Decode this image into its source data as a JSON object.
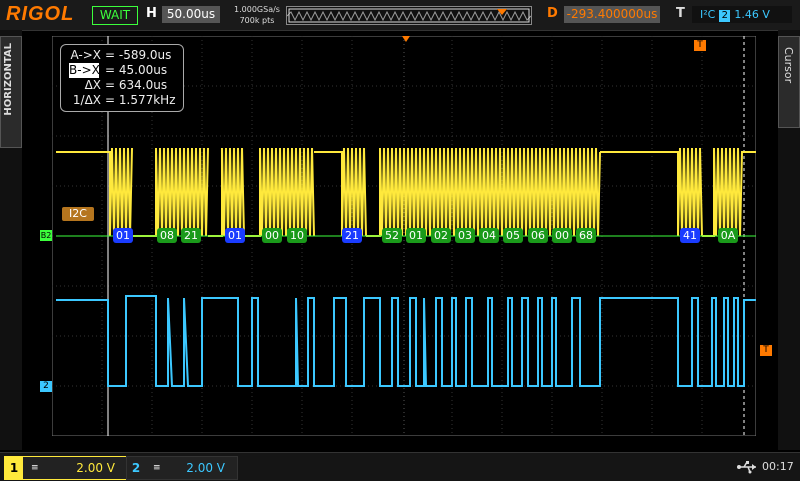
{
  "header": {
    "brand": "RIGOL",
    "status": "WAIT",
    "h_label": "H",
    "timebase": "50.00us",
    "sample_rate": "1.000GSa/s",
    "memory_depth": "700k pts",
    "d_label": "D",
    "delay": "-293.400000us",
    "t_label": "T",
    "trigger_protocol": "I²C",
    "trigger_source": "2",
    "trigger_level": "1.46 V"
  },
  "side_tabs": {
    "left": "HORIZONTAL",
    "right": "Cursor"
  },
  "cursor_readout": {
    "a_key": "A->X",
    "a_value": "= -589.0us",
    "b_key": "B->X",
    "b_value": "= 45.00us",
    "delta_key": "ΔX",
    "delta_value": "= 634.0us",
    "inv_key": "1/ΔX",
    "inv_value": "= 1.577kHz"
  },
  "decode": {
    "label": "I2C",
    "bus_marker": "B2",
    "packets": [
      {
        "value": "01",
        "kind": "address"
      },
      {
        "value": "08",
        "kind": "data"
      },
      {
        "value": "21",
        "kind": "data"
      },
      {
        "value": "01",
        "kind": "address"
      },
      {
        "value": "00",
        "kind": "data"
      },
      {
        "value": "10",
        "kind": "data"
      },
      {
        "value": "21",
        "kind": "address"
      },
      {
        "value": "52",
        "kind": "data"
      },
      {
        "value": "01",
        "kind": "data"
      },
      {
        "value": "02",
        "kind": "data"
      },
      {
        "value": "03",
        "kind": "data"
      },
      {
        "value": "04",
        "kind": "data"
      },
      {
        "value": "05",
        "kind": "data"
      },
      {
        "value": "06",
        "kind": "data"
      },
      {
        "value": "00",
        "kind": "data"
      },
      {
        "value": "68",
        "kind": "data"
      },
      {
        "value": "41",
        "kind": "address"
      },
      {
        "value": "0A",
        "kind": "data"
      }
    ]
  },
  "markers": {
    "ch2_ground": "2",
    "trigger_level_marker": "T",
    "trigger_pos_marker": "T"
  },
  "channels": [
    {
      "num": "1",
      "coupling": "≡",
      "scale": "2.00 V",
      "color": "#ffe93c"
    },
    {
      "num": "2",
      "coupling": "≡",
      "scale": "2.00 V",
      "color": "#3cc8ff"
    }
  ],
  "footer": {
    "clock": "00:17",
    "usb_icon": "usb-icon"
  },
  "colors": {
    "ch1": "#ffe93c",
    "ch2": "#3cc8ff",
    "accent": "#ff7a00",
    "decode_address": "#1a3cff",
    "decode_data": "#1a9a1a"
  }
}
